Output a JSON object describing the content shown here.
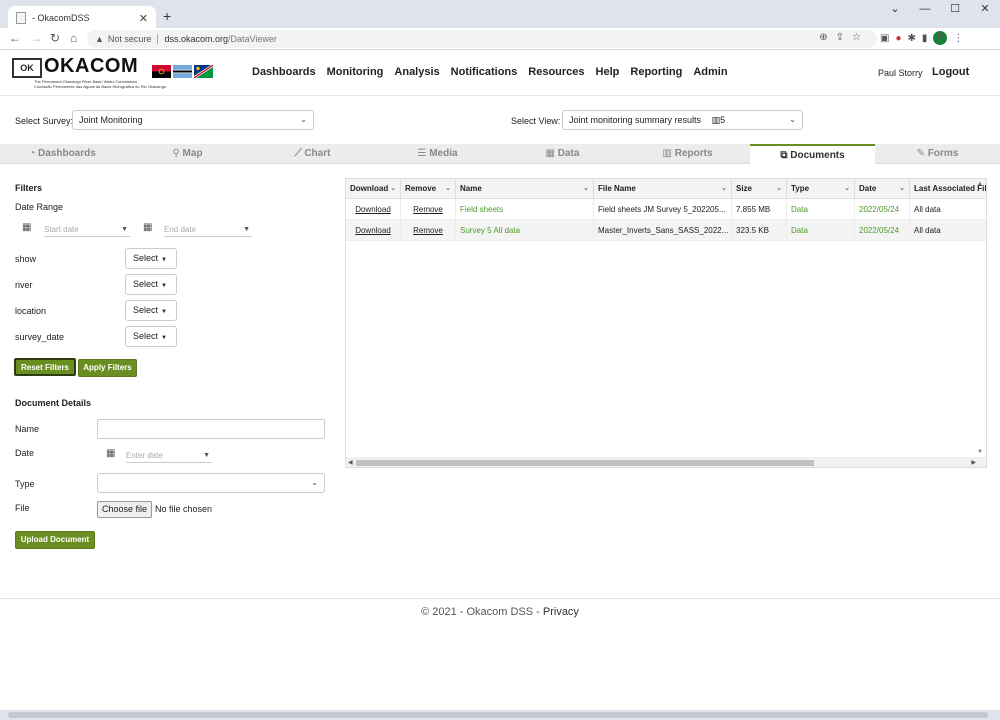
{
  "browser": {
    "tab_title": "- OkacomDSS",
    "address_security": "Not secure",
    "url_domain": "dss.okacom.org",
    "url_path": "/DataViewer",
    "avatar_letter": "P"
  },
  "header": {
    "logo_name": "OKACOM",
    "logo_mark": "OK",
    "logo_sub_1": "The Permanent Okavango River Basin Water Commission",
    "logo_sub_2": "Comissão Permanente das Águas da Bacia Hidrográfica do Rio Okavango",
    "nav": [
      "Dashboards",
      "Monitoring",
      "Analysis",
      "Notifications",
      "Resources",
      "Help",
      "Reporting",
      "Admin"
    ],
    "user_name": "Paul Storry",
    "logout_label": "Logout"
  },
  "survey": {
    "label": "Select Survey:",
    "value": "Joint Monitoring"
  },
  "view": {
    "label": "Select View:",
    "value": "Joint monitoring summary results",
    "count": "5"
  },
  "tabs": [
    {
      "label": "Dashboards",
      "icon": "gauge-icon"
    },
    {
      "label": "Map",
      "icon": "map-marker-icon"
    },
    {
      "label": "Chart",
      "icon": "line-chart-icon"
    },
    {
      "label": "Media",
      "icon": "list-icon"
    },
    {
      "label": "Data",
      "icon": "table-icon"
    },
    {
      "label": "Reports",
      "icon": "bar-chart-icon"
    },
    {
      "label": "Documents",
      "icon": "documents-icon",
      "active": true
    },
    {
      "label": "Forms",
      "icon": "edit-icon"
    }
  ],
  "filters": {
    "title": "Filters",
    "date_range_label": "Date Range",
    "start_placeholder": "Start date",
    "end_placeholder": "End date",
    "fields": [
      {
        "label": "show",
        "value": "Select"
      },
      {
        "label": "river",
        "value": "Select"
      },
      {
        "label": "location",
        "value": "Select"
      },
      {
        "label": "survey_date",
        "value": "Select"
      }
    ],
    "reset_label": "Reset Filters",
    "apply_label": "Apply Filters"
  },
  "document_details": {
    "title": "Document Details",
    "name_label": "Name",
    "name_value": "",
    "date_label": "Date",
    "date_placeholder": "Enter date",
    "type_label": "Type",
    "type_value": "",
    "file_label": "File",
    "choose_file_label": "Choose file",
    "no_file_text": "No file chosen",
    "upload_label": "Upload Document"
  },
  "grid": {
    "columns": [
      "Download",
      "Remove",
      "Name",
      "File Name",
      "Size",
      "Type",
      "Date",
      "Last Associated Filt"
    ],
    "rows": [
      {
        "download": "Download",
        "remove": "Remove",
        "name": "Field sheets",
        "file_name": "Field sheets JM Survey 5_202205...",
        "size": "7.855 MB",
        "type": "Data",
        "date": "2022/05/24",
        "last_filter": "All data"
      },
      {
        "download": "Download",
        "remove": "Remove",
        "name": "Survey 5 All data",
        "file_name": "Master_Inverts_Sans_SASS_2022...",
        "size": "323.5 KB",
        "type": "Data",
        "date": "2022/05/24",
        "last_filter": "All data"
      }
    ]
  },
  "footer": {
    "copyright": "© 2021 - Okacom DSS - ",
    "privacy": "Privacy"
  },
  "colors": {
    "accent": "#6b8e23",
    "link_green": "#4c9a2a"
  }
}
